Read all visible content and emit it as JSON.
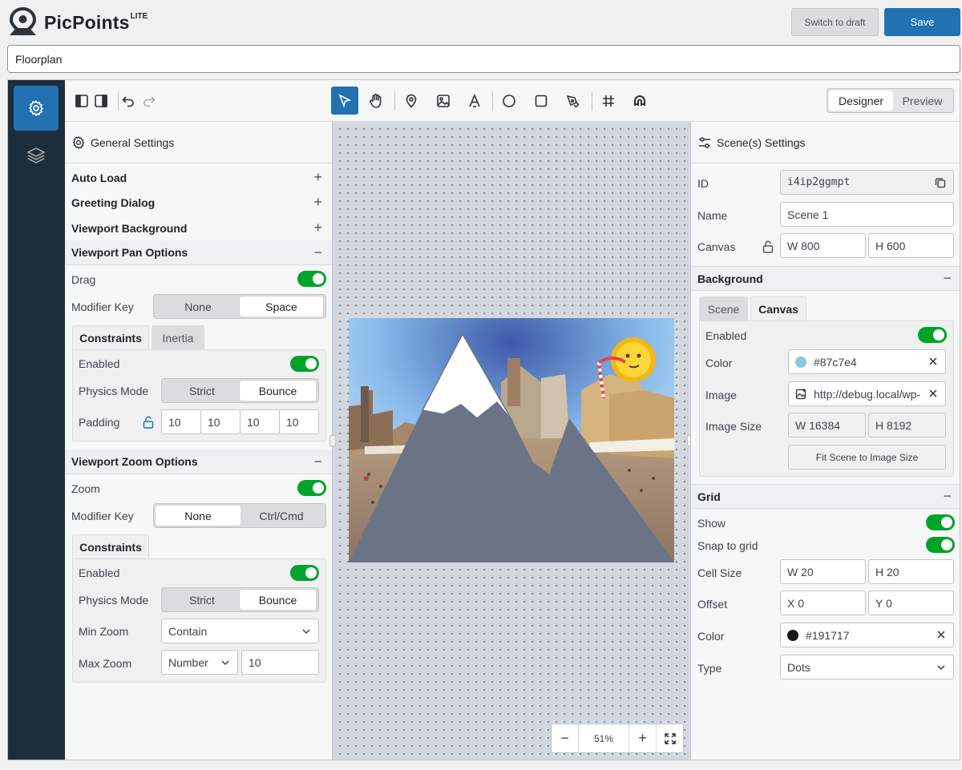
{
  "app": {
    "name": "PicPoints",
    "edition": "LITE"
  },
  "header": {
    "switch_draft": "Switch to draft",
    "save": "Save",
    "title_value": "Floorplan"
  },
  "mode": {
    "designer": "Designer",
    "preview": "Preview"
  },
  "general": {
    "title": "General Settings",
    "sections": {
      "auto_load": "Auto Load",
      "greeting": "Greeting Dialog",
      "viewport_bg": "Viewport Background",
      "pan": "Viewport Pan Options",
      "zoom": "Viewport Zoom Options"
    },
    "signs": {
      "plus": "+",
      "minus": "−"
    },
    "pan": {
      "drag": "Drag",
      "modifier": "Modifier Key",
      "mod_none": "None",
      "mod_space": "Space",
      "tab_constraints": "Constraints",
      "tab_inertia": "Inertia",
      "enabled": "Enabled",
      "physics": "Physics Mode",
      "strict": "Strict",
      "bounce": "Bounce",
      "padding": "Padding",
      "padding_values": [
        "10",
        "10",
        "10",
        "10"
      ]
    },
    "zoom": {
      "zoom": "Zoom",
      "modifier": "Modifier Key",
      "mod_none": "None",
      "mod_ctrl": "Ctrl/Cmd",
      "tab_constraints": "Constraints",
      "enabled": "Enabled",
      "physics": "Physics Mode",
      "strict": "Strict",
      "bounce": "Bounce",
      "min_zoom": "Min Zoom",
      "min_value": "Contain",
      "max_zoom": "Max Zoom",
      "max_type": "Number",
      "max_value": "10"
    }
  },
  "canvas": {
    "zoom_level": "51%",
    "minus": "−",
    "plus": "+"
  },
  "scene": {
    "title": "Scene(s) Settings",
    "id_label": "ID",
    "id_value": "i4ip2ggmpt",
    "name_label": "Name",
    "name_value": "Scene 1",
    "canvas_label": "Canvas",
    "canvas_w": "W 800",
    "canvas_h": "H 600",
    "background": "Background",
    "tab_scene": "Scene",
    "tab_canvas": "Canvas",
    "enabled": "Enabled",
    "color": "Color",
    "color_value": "#87c7e4",
    "image": "Image",
    "image_value": "http://debug.local/wp-",
    "image_size": "Image Size",
    "img_w": "W 16384",
    "img_h": "H 8192",
    "fit": "Fit Scene to Image Size",
    "grid": "Grid",
    "show": "Show",
    "snap": "Snap to grid",
    "cell_size": "Cell Size",
    "cell_w": "W 20",
    "cell_h": "H 20",
    "offset": "Offset",
    "off_x": "X 0",
    "off_y": "Y 0",
    "grid_color": "Color",
    "grid_color_value": "#191717",
    "type": "Type",
    "type_value": "Dots",
    "minus": "−"
  },
  "colors": {
    "accent": "#2271b1",
    "toggle_on": "#00a32a",
    "rail": "#1e2d3b",
    "bg_swatch": "#87c7e4",
    "grid_swatch": "#191717"
  }
}
